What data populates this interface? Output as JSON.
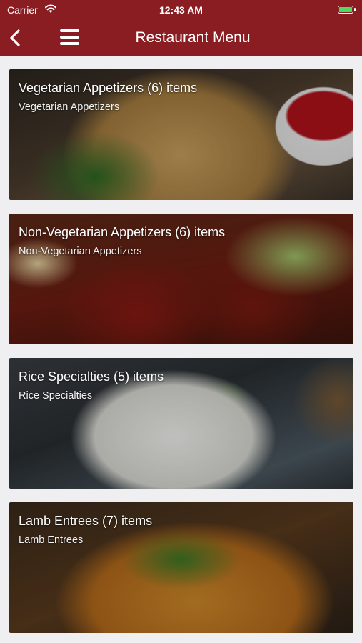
{
  "status_bar": {
    "carrier": "Carrier",
    "time": "12:43 AM",
    "wifi_icon": "wifi-icon",
    "battery_icon": "battery-charging-icon"
  },
  "nav": {
    "title": "Restaurant Menu",
    "back_icon": "chevron-left-icon",
    "menu_icon": "hamburger-menu-icon",
    "background_color": "#8a1d22"
  },
  "categories": [
    {
      "title": "Vegetarian Appetizers (6) items",
      "subtitle": "Vegetarian Appetizers"
    },
    {
      "title": "Non-Vegetarian Appetizers (6) items",
      "subtitle": "Non-Vegetarian Appetizers"
    },
    {
      "title": "Rice Specialties (5) items",
      "subtitle": "Rice Specialties"
    },
    {
      "title": "Lamb Entrees (7) items",
      "subtitle": "Lamb Entrees"
    }
  ]
}
